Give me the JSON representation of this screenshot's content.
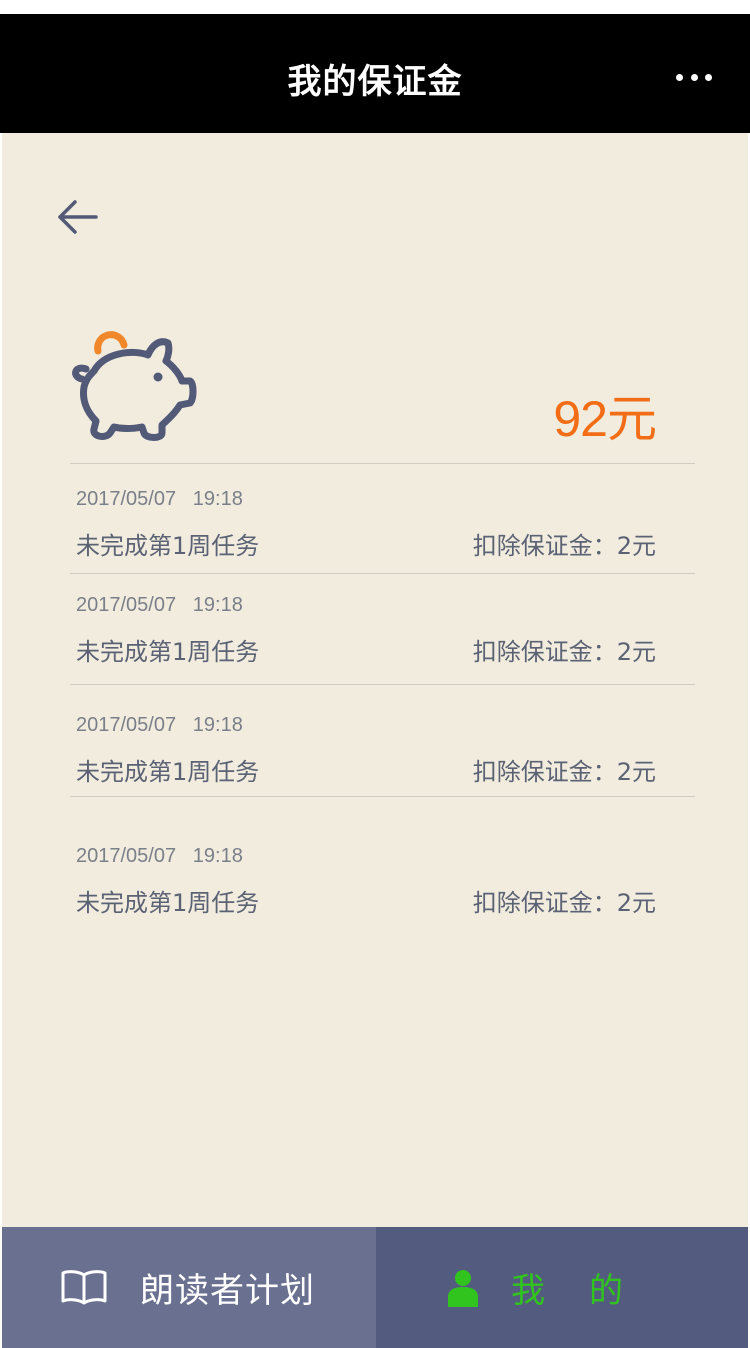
{
  "header": {
    "title": "我的保证金",
    "more_icon": "more-dots-icon"
  },
  "balance": {
    "amount": "92元",
    "icon": "piggy-bank-icon",
    "accent": "#f26d16"
  },
  "records": [
    {
      "date": "2017/05/07   19:18",
      "desc": "未完成第1周任务",
      "deduct": "扣除保证金：2元"
    },
    {
      "date": "2017/05/07   19:18",
      "desc": "未完成第1周任务",
      "deduct": "扣除保证金：2元"
    },
    {
      "date": "2017/05/07   19:18",
      "desc": "未完成第1周任务",
      "deduct": "扣除保证金：2元"
    },
    {
      "date": "2017/05/07   19:18",
      "desc": "未完成第1周任务",
      "deduct": "扣除保证金：2元"
    }
  ],
  "tabbar": {
    "plan": {
      "label": "朗读者计划",
      "icon": "book-icon"
    },
    "mine": {
      "label": "我的",
      "icon": "person-icon",
      "active_color": "#31c41f"
    }
  }
}
